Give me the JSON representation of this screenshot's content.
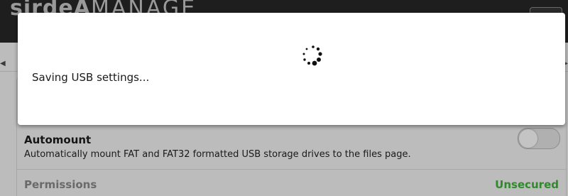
{
  "header": {
    "brand_bold": "sirdeA",
    "brand_light": "MANAGE"
  },
  "modal": {
    "message": "Saving USB settings..."
  },
  "settings": {
    "automount": {
      "title": "Automount",
      "description": "Automatically mount FAT and FAT32 formatted USB storage drives to the files page.",
      "enabled": false
    },
    "permissions": {
      "label": "Permissions",
      "status": "Unsecured"
    }
  },
  "colors": {
    "header_bg": "#1e1e1e",
    "overlay_bg": "#bcbcbc",
    "modal_bg": "#ffffff",
    "status_ok": "#2f8a2c",
    "spinner": "#111111"
  }
}
